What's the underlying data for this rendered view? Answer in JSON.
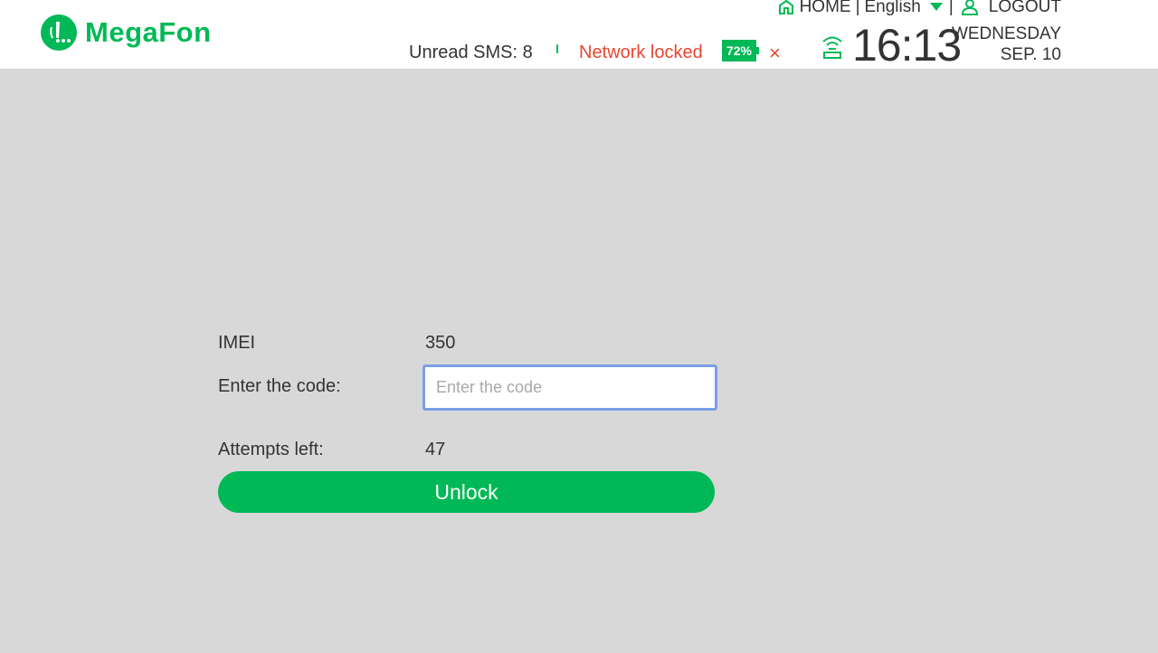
{
  "brand": {
    "name": "MegaFon",
    "color": "#00b956"
  },
  "nav": {
    "home_label": "HOME",
    "separator": "|",
    "language": "English",
    "logout_label": "LOGOUT"
  },
  "status": {
    "sms_label": "Unread SMS: 8",
    "network_status": "Network locked",
    "battery": "72%",
    "close_symbol": "×",
    "alert_color": "#e8452f"
  },
  "clock": {
    "time": "16:13",
    "weekday": "WEDNESDAY",
    "date": "SEP. 10"
  },
  "form": {
    "imei_label": "IMEI",
    "imei_value": "350",
    "code_label": "Enter the code:",
    "code_value": "",
    "code_placeholder": "Enter the code",
    "attempts_label": "Attempts left:",
    "attempts_value": "47",
    "unlock_label": "Unlock"
  }
}
